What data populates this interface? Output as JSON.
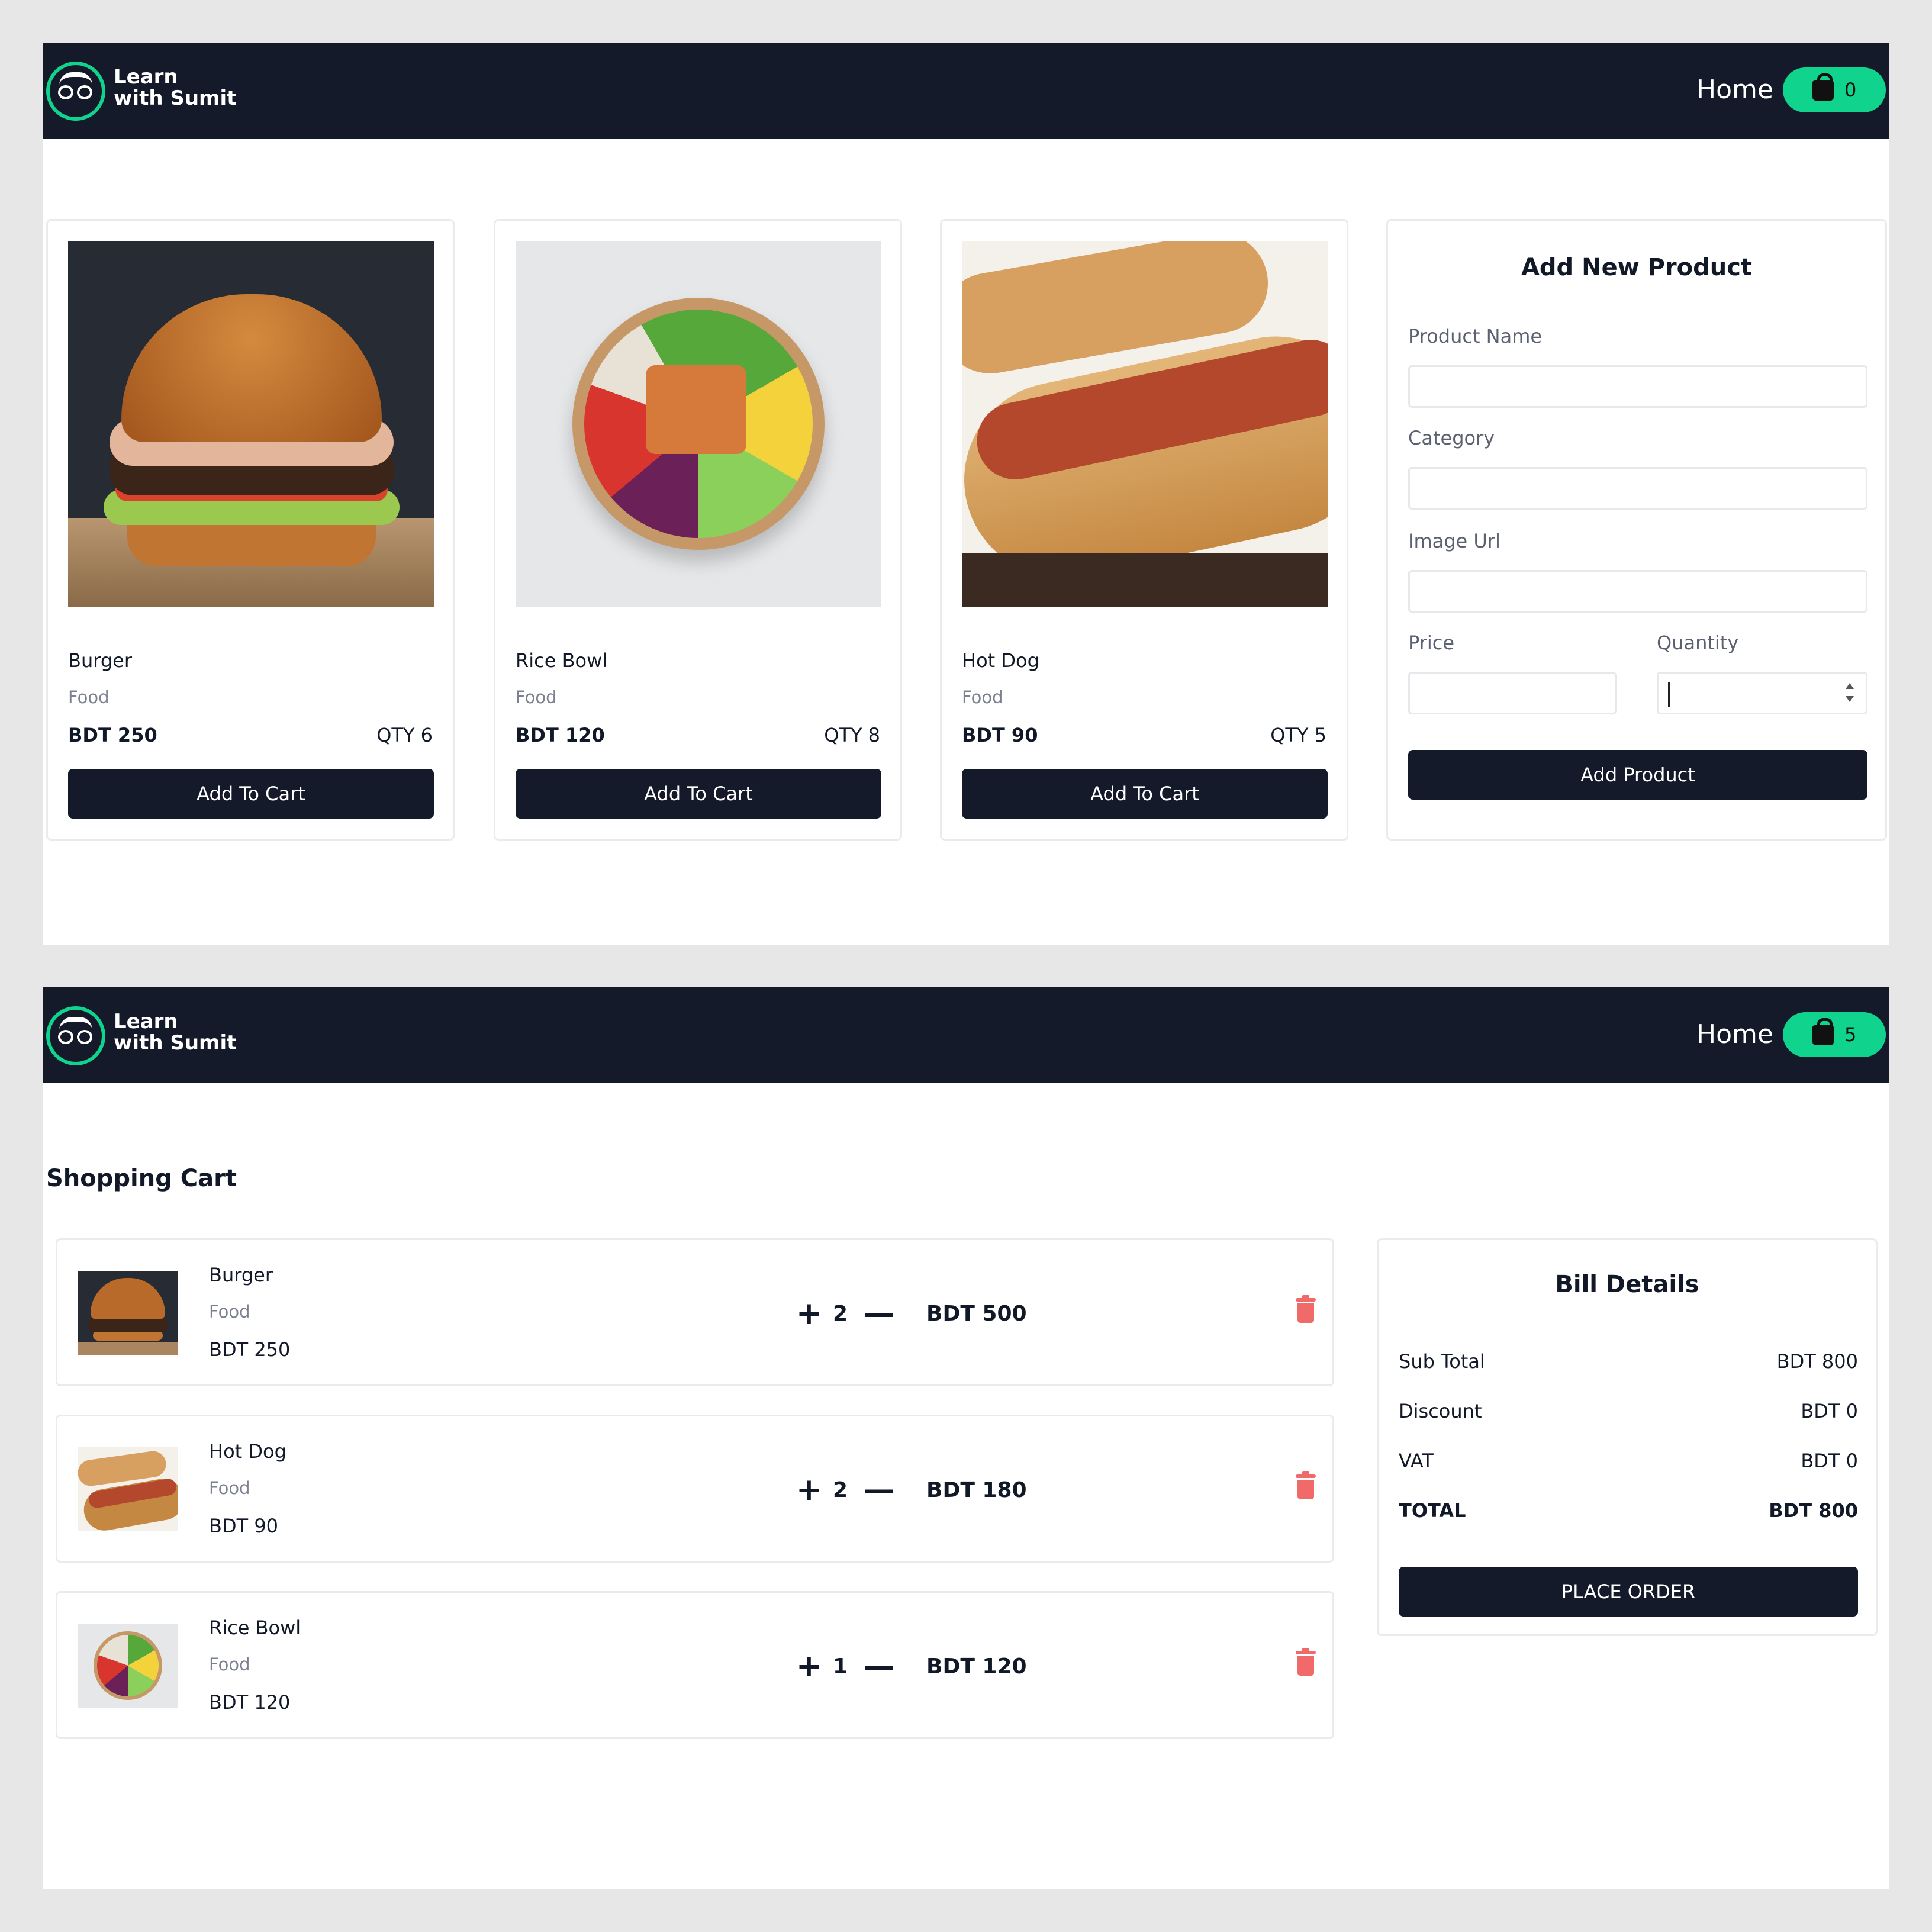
{
  "nav": {
    "brand_line1": "Learn",
    "brand_line2": "with Sumit",
    "home_label": "Home"
  },
  "products_page": {
    "cart_count": "0",
    "products": [
      {
        "name": "Burger",
        "category": "Food",
        "price": "BDT 250",
        "qty": "QTY 6",
        "button": "Add To Cart"
      },
      {
        "name": "Rice Bowl",
        "category": "Food",
        "price": "BDT 120",
        "qty": "QTY 8",
        "button": "Add To Cart"
      },
      {
        "name": "Hot Dog",
        "category": "Food",
        "price": "BDT 90",
        "qty": "QTY 5",
        "button": "Add To Cart"
      }
    ],
    "form": {
      "title": "Add New Product",
      "product_name_label": "Product Name",
      "category_label": "Category",
      "image_url_label": "Image Url",
      "price_label": "Price",
      "quantity_label": "Quantity",
      "submit_label": "Add Product"
    }
  },
  "cart_page": {
    "cart_count": "5",
    "heading": "Shopping Cart",
    "items": [
      {
        "name": "Burger",
        "category": "Food",
        "price": "BDT 250",
        "plus": "+",
        "count": "2",
        "minus": "—",
        "line_total": "BDT 500"
      },
      {
        "name": "Hot Dog",
        "category": "Food",
        "price": "BDT 90",
        "plus": "+",
        "count": "2",
        "minus": "—",
        "line_total": "BDT 180"
      },
      {
        "name": "Rice Bowl",
        "category": "Food",
        "price": "BDT 120",
        "plus": "+",
        "count": "1",
        "minus": "—",
        "line_total": "BDT 120"
      }
    ],
    "bill": {
      "title": "Bill Details",
      "rows": [
        {
          "label": "Sub Total",
          "value": "BDT 800"
        },
        {
          "label": "Discount",
          "value": "BDT 0"
        },
        {
          "label": "VAT",
          "value": "BDT 0"
        },
        {
          "label": "TOTAL",
          "value": "BDT 800"
        }
      ],
      "button": "PLACE ORDER"
    }
  },
  "colors": {
    "nav_bg": "#141a2a",
    "accent": "#10d48e",
    "button_bg": "#141a2a",
    "delete": "#f06a6a"
  },
  "icons": {
    "logo": "glasses-logo-icon",
    "cart": "shopping-bag-icon",
    "delete": "trash-icon",
    "increment": "plus-icon",
    "decrement": "minus-icon"
  }
}
